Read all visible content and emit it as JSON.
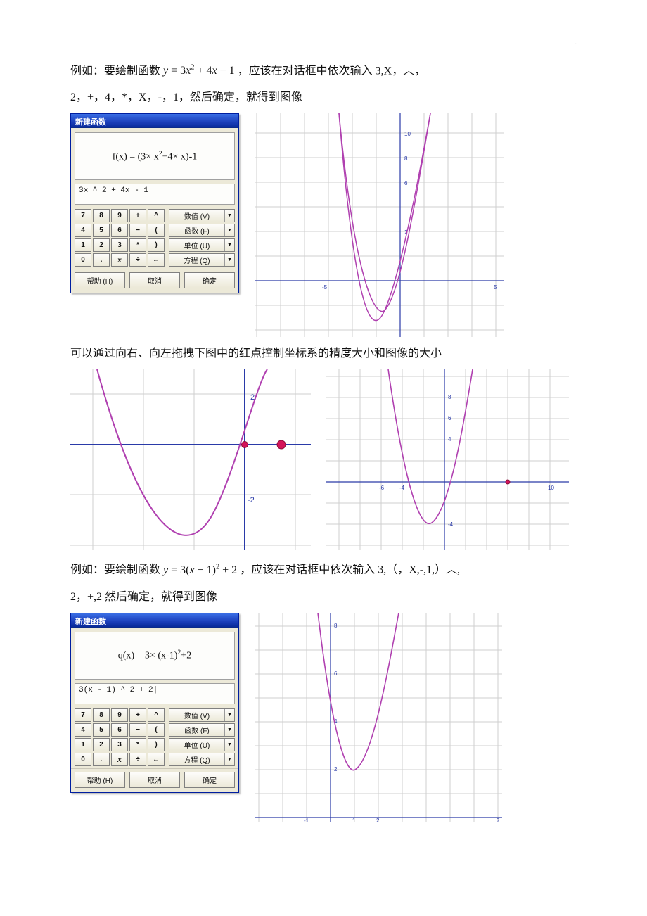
{
  "p1": {
    "a1": "例如：要绘制函数 ",
    "eq1_y": "y",
    "eq1_x": "x",
    "eq1_p": "2",
    "eq1_x2": "x",
    "a2": " ，应该在对话框中依次输入 3,X，︿，",
    "b": "2，+，4，*，X，-，1，然后确定，就得到图像"
  },
  "p2": "可以通过向右、向左拖拽下图中的红点控制坐标系的精度大小和图像的大小",
  "p3": {
    "a1": "例如：要绘制函数 ",
    "eq_y": "y",
    "eq_x": "x",
    "eq_p": "2",
    "a2": " ，应该在对话框中依次输入 3,（，X,-,1,）︿,",
    "b": "2，+,2 然后确定，就得到图像"
  },
  "dlg": {
    "title": "新建函数"
  },
  "dlg1": {
    "fxpre": "f(x) = (3× x",
    "fxsup": "2",
    "fxpost": "+4× x)-1",
    "expr": "3x ^ 2 + 4x - 1"
  },
  "dlg2": {
    "fxpre": "q(x) = 3× (x-1)",
    "fxsup": "2",
    "fxpost": "+2",
    "expr": "3(x - 1) ^ 2 + 2|"
  },
  "keys": [
    "7",
    "8",
    "9",
    "+",
    "^",
    "4",
    "5",
    "6",
    "−",
    "(",
    "1",
    "2",
    "3",
    "*",
    ")",
    "0",
    ".",
    "x",
    "÷",
    "←"
  ],
  "side": [
    "数值 (V)",
    "函数 (F)",
    "单位 (U)",
    "方程 (Q)"
  ],
  "btns": {
    "help": "帮助 (H)",
    "cancel": "取消",
    "ok": "确定"
  },
  "plot1": {
    "x1": "-5",
    "x2": "5",
    "y1": "2",
    "y2": "6",
    "y3": "8",
    "y4": "10"
  },
  "plot2a": {
    "y1": "2",
    "y2": "-2"
  },
  "plot2b": {
    "x1": "-6",
    "x2": "-4",
    "x3": "10",
    "y1": "4",
    "y2": "6",
    "y3": "8",
    "yminus": "-4"
  },
  "plot3": {
    "y1": "2",
    "y2": "4",
    "y3": "6",
    "y4": "8",
    "x0": "-1",
    "x1": "1",
    "x2": "2",
    "x3": "7"
  },
  "chart_data": [
    {
      "type": "line",
      "title": "f(x) = 3x^2 + 4x - 1",
      "series": [
        {
          "name": "f(x)",
          "expr": "3*x^2 + 4*x - 1"
        }
      ],
      "xlim": [
        -6,
        5
      ],
      "ylim": [
        -2,
        10
      ],
      "xticks": [
        -5,
        5
      ],
      "yticks": [
        2,
        6,
        8,
        10
      ]
    },
    {
      "type": "line",
      "title": "zoom-left f(x) = 3x^2+4x-1",
      "series": [
        {
          "name": "f(x)",
          "expr": "3*x^2 + 4*x - 1"
        }
      ],
      "xlim": [
        -3,
        1.5
      ],
      "ylim": [
        -3,
        3
      ],
      "yticks": [
        -2,
        2
      ],
      "control_points": [
        {
          "x": 0,
          "y": 0
        },
        {
          "x": 0.7,
          "y": 0
        }
      ]
    },
    {
      "type": "line",
      "title": "zoom-right f(x) = 3x^2+4x-1",
      "series": [
        {
          "name": "f(x)",
          "expr": "3*x^2 + 4*x - 1"
        }
      ],
      "xlim": [
        -10,
        10
      ],
      "ylim": [
        -6,
        10
      ],
      "xticks": [
        -6,
        -4,
        10
      ],
      "yticks": [
        -4,
        4,
        6,
        8
      ],
      "control_points": [
        {
          "x": 6,
          "y": 0
        }
      ]
    },
    {
      "type": "line",
      "title": "q(x) = 3(x-1)^2 + 2",
      "series": [
        {
          "name": "q(x)",
          "expr": "3*(x-1)^2 + 2"
        }
      ],
      "xlim": [
        -2,
        7
      ],
      "ylim": [
        0,
        9
      ],
      "xticks": [
        -1,
        1,
        2,
        7
      ],
      "yticks": [
        2,
        4,
        6,
        8
      ]
    }
  ]
}
